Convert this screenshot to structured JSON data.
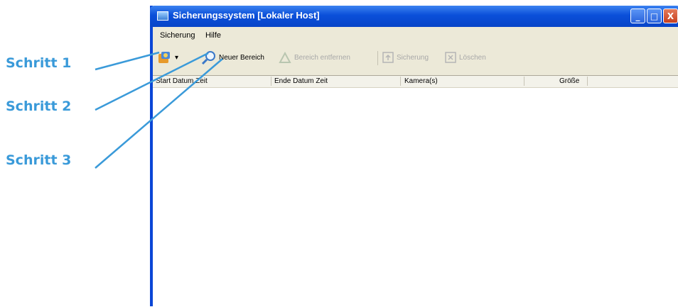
{
  "callouts": [
    "Schritt 1",
    "Schritt 2",
    "Schritt 3"
  ],
  "window": {
    "title": "Sicherungssystem [Lokaler Host]",
    "controls": {
      "minimize": "_",
      "maximize": "□",
      "close": "X"
    }
  },
  "menu": [
    "Sicherung",
    "Hilfe"
  ],
  "toolbar": {
    "backup_dropdown": "▾",
    "new_range": "Neuer Bereich",
    "remove_range": "Bereich entfernen",
    "save": "Sicherung",
    "delete": "Löschen"
  },
  "columns": [
    "Start Datum Zeit",
    "Ende Datum Zeit",
    "Kamera(s)",
    "Größe"
  ],
  "colors": {
    "callout": "#3a9ad9",
    "titlebar": "#0a4fd9",
    "window_bg": "#ece9d8"
  }
}
